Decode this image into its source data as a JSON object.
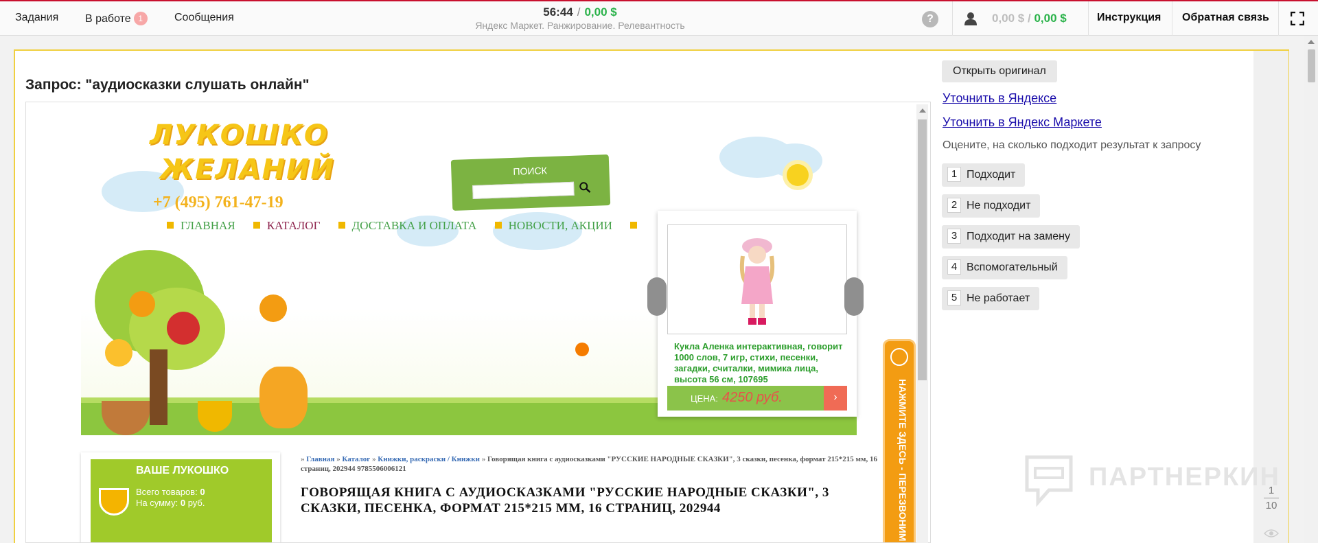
{
  "topbar": {
    "nav": [
      {
        "label": "Задания"
      },
      {
        "label": "В работе",
        "badge": "1"
      },
      {
        "label": "Сообщения"
      }
    ],
    "timer": "56:44",
    "earned": "0,00 $",
    "project": "Яндекс Маркет. Ранжирование. Релевантность",
    "balance_pending": "0,00 $",
    "balance_available": "0,00 $",
    "instruction_label": "Инструкция",
    "feedback_label": "Обратная связь",
    "icons": [
      "help-icon",
      "user-icon",
      "fullscreen-icon"
    ]
  },
  "task": {
    "query_label": "Запрос: \"аудиосказки слушать онлайн\""
  },
  "site": {
    "logo_line1": "ЛУКОШКО",
    "logo_line2": "ЖЕЛАНИЙ",
    "phone": "+7 (495) 761-47-19",
    "search_title": "ПОИСК",
    "menu": [
      {
        "label": "ГЛАВНАЯ",
        "color": "#43a047"
      },
      {
        "label": "КАТАЛОГ",
        "color": "#8e244d"
      },
      {
        "label": "ДОСТАВКА И ОПЛАТА",
        "color": "#43a047"
      },
      {
        "label": "НОВОСТИ, АКЦИИ",
        "color": "#43a047"
      }
    ],
    "slider": {
      "caption": "Кукла Аленка интерактивная, говорит 1000 слов, 7 игр, стихи, песенки, загадки, считалки, мимика лица, высота 56 см, 107695",
      "price_label": "ЦЕНА:",
      "price_value": "4250 руб.",
      "price_button": "›"
    },
    "callback_text": "НАЖМИТЕ ЗДЕСЬ - ПЕРЕЗВОНИМ",
    "cart": {
      "title": "ВАШЕ ЛУКОШКО",
      "items_label": "Всего товаров:",
      "items_value": "0",
      "sum_label": "На сумму:",
      "sum_value": "0",
      "sum_unit": "руб."
    },
    "breadcrumbs": {
      "prefix": "»",
      "links": [
        "Главная",
        "Каталог",
        "Книжки, раскраски / Книжки"
      ],
      "separator": "»",
      "current": "Говорящая книга с аудиосказками \"РУССКИЕ НАРОДНЫЕ СКАЗКИ\", 3 сказки, песенка, формат 215*215 мм, 16 страниц, 202944 9785506006121"
    },
    "product_title": "ГОВОРЯЩАЯ КНИГА С АУДИОСКАЗКАМИ \"РУССКИЕ НАРОДНЫЕ СКАЗКИ\", 3 СКАЗКИ, ПЕСЕНКА, ФОРМАТ 215*215 ММ, 16 СТРАНИЦ, 202944"
  },
  "side": {
    "open_original": "Открыть оригинал",
    "refine_yandex": "Уточнить в Яндексе",
    "refine_market": "Уточнить в Яндекс Маркете",
    "hint": "Оцените, на сколько подходит результат к запросу",
    "options": [
      {
        "key": "1",
        "label": "Подходит"
      },
      {
        "key": "2",
        "label": "Не подходит"
      },
      {
        "key": "3",
        "label": "Подходит на замену"
      },
      {
        "key": "4",
        "label": "Вспомогательный"
      },
      {
        "key": "5",
        "label": "Не работает"
      }
    ]
  },
  "watermark": "ПАРТНЕРКИН",
  "pager": {
    "current": "1",
    "total": "10"
  },
  "colors": {
    "accent_green": "#2ab24a",
    "panel_border": "#f0d040",
    "top_border": "#c8102e"
  }
}
